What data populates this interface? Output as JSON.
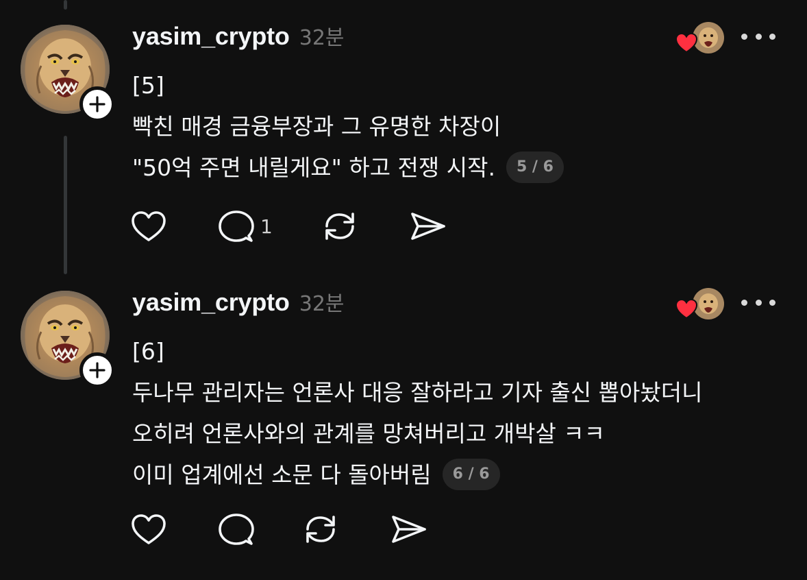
{
  "posts": [
    {
      "username": "yasim_crypto",
      "time": "32분",
      "lines": [
        "[5]",
        "빡친 매경 금융부장과 그 유명한 차장이",
        "\"50억 주면 내릴게요\" 하고 전쟁 시작."
      ],
      "page_indicator": "5 / 6",
      "reply_count": "1"
    },
    {
      "username": "yasim_crypto",
      "time": "32분",
      "lines": [
        "[6]",
        "두나무 관리자는 언론사 대응 잘하라고 기자 출신 뽑아놨더니",
        "오히려 언론사와의 관계를 망쳐버리고 개박살 ㅋㅋ",
        "이미 업계에선 소문 다 돌아버림"
      ],
      "page_indicator": "6 / 6",
      "reply_count": ""
    }
  ],
  "icons": {
    "like": "heart-outline-icon",
    "reply": "comment-bubble-icon",
    "repost": "repost-arrows-icon",
    "share": "send-paper-plane-icon",
    "more": "ellipsis-icon",
    "follow": "plus-icon"
  },
  "colors": {
    "background": "#101010",
    "text": "#f3f5f7",
    "muted": "#777777",
    "heart": "#ff3040"
  }
}
